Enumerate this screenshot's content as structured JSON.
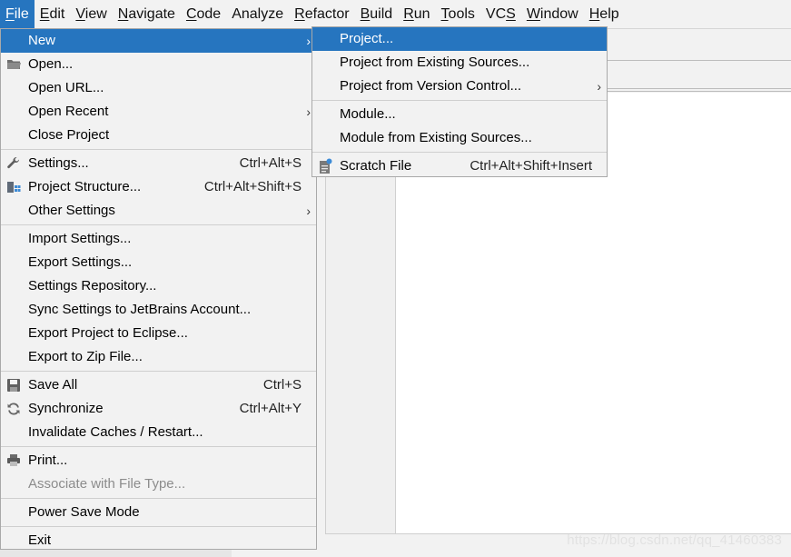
{
  "menubar": {
    "items": [
      {
        "label": "File",
        "mnemonic": "F",
        "rest": "ile",
        "active": true
      },
      {
        "label": "Edit",
        "mnemonic": "E",
        "rest": "dit"
      },
      {
        "label": "View",
        "mnemonic": "V",
        "rest": "iew"
      },
      {
        "label": "Navigate",
        "mnemonic": "N",
        "rest": "avigate"
      },
      {
        "label": "Code",
        "mnemonic": "C",
        "rest": "ode"
      },
      {
        "label": "Analyze",
        "mnemonic": "",
        "rest": "Analyze"
      },
      {
        "label": "Refactor",
        "mnemonic": "R",
        "rest": "efactor"
      },
      {
        "label": "Build",
        "mnemonic": "B",
        "rest": "uild"
      },
      {
        "label": "Run",
        "mnemonic": "R",
        "rest": "un"
      },
      {
        "label": "Tools",
        "mnemonic": "T",
        "rest": "ools"
      },
      {
        "label": "VCS",
        "mnemonic": "",
        "rest": "VCS",
        "underline_all": "S"
      },
      {
        "label": "Window",
        "mnemonic": "W",
        "rest": "indow"
      },
      {
        "label": "Help",
        "mnemonic": "H",
        "rest": "elp"
      }
    ]
  },
  "file_menu": {
    "items": [
      {
        "label": "New",
        "submenu": true,
        "selected": true
      },
      {
        "label": "Open...",
        "icon": "folder-icon"
      },
      {
        "label": "Open URL..."
      },
      {
        "label": "Open Recent",
        "submenu": true
      },
      {
        "label": "Close Project"
      },
      {
        "separator": true
      },
      {
        "label": "Settings...",
        "shortcut": "Ctrl+Alt+S",
        "icon": "wrench-icon"
      },
      {
        "label": "Project Structure...",
        "shortcut": "Ctrl+Alt+Shift+S",
        "icon": "project-structure-icon"
      },
      {
        "label": "Other Settings",
        "submenu": true
      },
      {
        "separator": true
      },
      {
        "label": "Import Settings..."
      },
      {
        "label": "Export Settings..."
      },
      {
        "label": "Settings Repository..."
      },
      {
        "label": "Sync Settings to JetBrains Account..."
      },
      {
        "label": "Export Project to Eclipse..."
      },
      {
        "label": "Export to Zip File..."
      },
      {
        "separator": true
      },
      {
        "label": "Save All",
        "shortcut": "Ctrl+S",
        "icon": "save-icon"
      },
      {
        "label": "Synchronize",
        "shortcut": "Ctrl+Alt+Y",
        "icon": "sync-icon"
      },
      {
        "label": "Invalidate Caches / Restart..."
      },
      {
        "separator": true
      },
      {
        "label": "Print...",
        "icon": "print-icon"
      },
      {
        "label": "Associate with File Type...",
        "disabled": true
      },
      {
        "separator": true
      },
      {
        "label": "Power Save Mode"
      },
      {
        "separator": true
      },
      {
        "label": "Exit"
      }
    ]
  },
  "new_submenu": {
    "items": [
      {
        "label": "Project...",
        "selected": true
      },
      {
        "label": "Project from Existing Sources..."
      },
      {
        "label": "Project from Version Control...",
        "submenu": true
      },
      {
        "separator": true
      },
      {
        "label": "Module..."
      },
      {
        "label": "Module from Existing Sources..."
      },
      {
        "separator": true
      },
      {
        "label": "Scratch File",
        "shortcut": "Ctrl+Alt+Shift+Insert",
        "icon": "scratch-file-icon"
      }
    ]
  },
  "watermark": "https://blog.csdn.net/qq_41460383",
  "colors": {
    "selection": "#2675bf",
    "menu_bg": "#f2f2f2"
  }
}
